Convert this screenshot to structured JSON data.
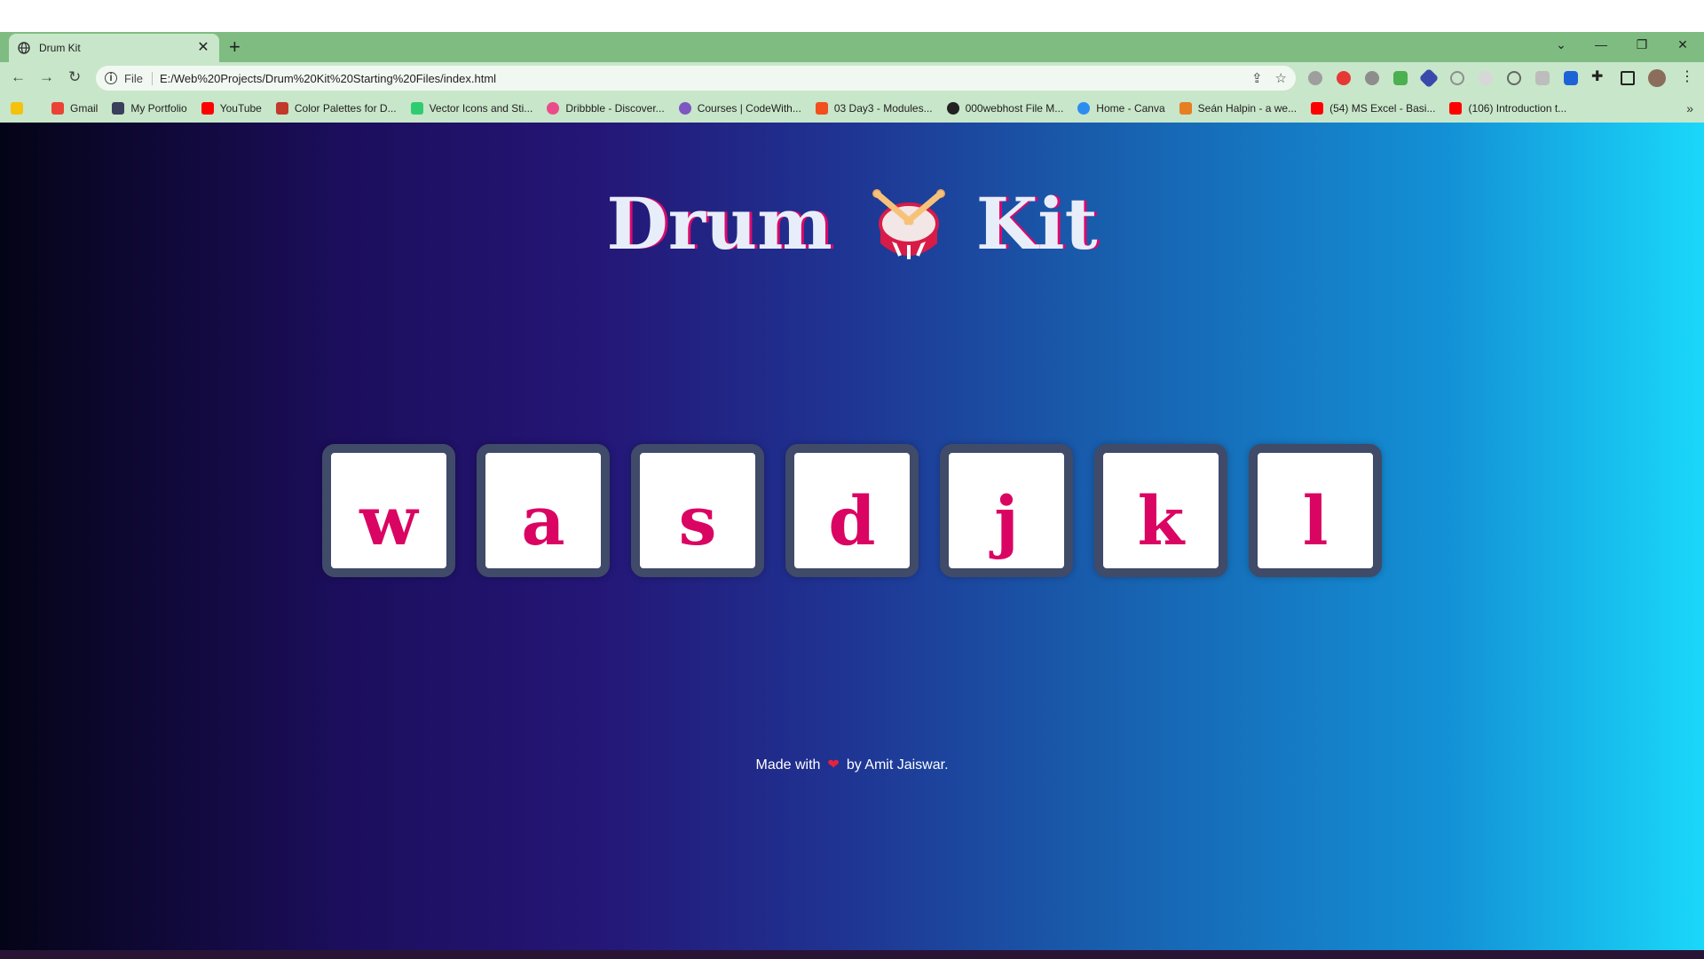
{
  "browser": {
    "tab_title": "Drum Kit",
    "tab_close": "✕",
    "new_tab": "+",
    "window_controls": {
      "tab_search": "⌄",
      "minimize": "—",
      "restore": "❐",
      "close": "✕"
    },
    "nav": {
      "back": "←",
      "forward": "→",
      "reload": "↻"
    },
    "address": {
      "scheme": "File",
      "url": "E:/Web%20Projects/Drum%20Kit%20Starting%20Files/index.html",
      "share_icon": "⇪",
      "star_icon": "☆"
    },
    "bookmarks": [
      {
        "label": "Gmail",
        "color": "#ea4335"
      },
      {
        "label": "My Portfolio",
        "color": "#3a3f5c"
      },
      {
        "label": "YouTube",
        "color": "#ff0000"
      },
      {
        "label": "Color Palettes for D...",
        "color": "#c0392b"
      },
      {
        "label": "Vector Icons and Sti...",
        "color": "#2ecc71"
      },
      {
        "label": "Dribbble - Discover...",
        "color": "#ea4c89"
      },
      {
        "label": "Courses | CodeWith...",
        "color": "#7e57c2"
      },
      {
        "label": "03 Day3 - Modules...",
        "color": "#f24e1e"
      },
      {
        "label": "000webhost File M...",
        "color": "#222222"
      },
      {
        "label": "Home - Canva",
        "color": "#2d8cf0"
      },
      {
        "label": "Seán Halpin - a we...",
        "color": "#e67e22"
      },
      {
        "label": "(54) MS Excel - Basi...",
        "color": "#ff0000"
      },
      {
        "label": "(106) Introduction t...",
        "color": "#ff0000"
      }
    ],
    "bookmarks_more": "»"
  },
  "page": {
    "title_left": "Drum",
    "title_right": "Kit",
    "keys": [
      "w",
      "a",
      "s",
      "d",
      "j",
      "k",
      "l"
    ],
    "footer_before": "Made with",
    "footer_heart": "❤",
    "footer_after": "by Amit Jaiswar."
  },
  "colors": {
    "key_letter": "#da0463",
    "key_border": "#404a69",
    "title_shadow": "#db0a6d",
    "browser_frame": "#7fbc81",
    "toolbar": "#c8e6c9"
  }
}
